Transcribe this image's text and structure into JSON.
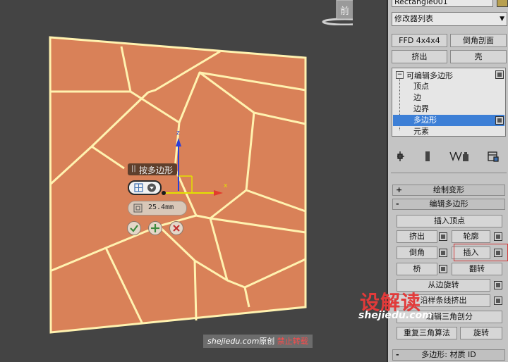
{
  "panel": {
    "object_name": "Rectangle001",
    "modifier_list": "修改器列表",
    "buttons_row1": [
      "FFD 4x4x4",
      "倒角剖面"
    ],
    "buttons_row2": [
      "挤出",
      "壳"
    ],
    "stack": {
      "root": "可编辑多边形",
      "items": [
        "顶点",
        "边",
        "边界",
        "多边形",
        "元素"
      ],
      "selected": "多边形"
    },
    "rollouts": {
      "paint_deform": "绘制变形",
      "edit_polygons": "编辑多边形",
      "material_ids": "多边形: 材质 ID"
    },
    "edit_polygons": {
      "insert_vertex": "插入顶点",
      "extrude": "挤出",
      "outline": "轮廓",
      "bevel": "倒角",
      "inset": "插入",
      "bridge": "桥",
      "flip": "翻转",
      "hinge": "从边旋转",
      "extrude_spline": "沿样条线挤出",
      "edit_tri": "编辑三角剖分",
      "retriangulate": "重复三角算法",
      "turn": "旋转"
    }
  },
  "viewport": {
    "viewcube_label": "前",
    "gizmo": {
      "z_label": "z",
      "x_label": "x"
    },
    "caddy": {
      "title": "按多边形",
      "value": "25.4mm"
    }
  },
  "watermark": {
    "logo_text": "设解读",
    "logo_url": "shejiedu.com",
    "credit_site": "shejiedu.com",
    "credit_original": "原创",
    "credit_notice": "禁止转载"
  },
  "colors": {
    "viewport_bg": "#444444",
    "plane_fill": "#d98158",
    "edge_highlight": "#fff2b0",
    "selection_blue": "#3d7fd6",
    "highlight_box": "#d13b3b"
  }
}
